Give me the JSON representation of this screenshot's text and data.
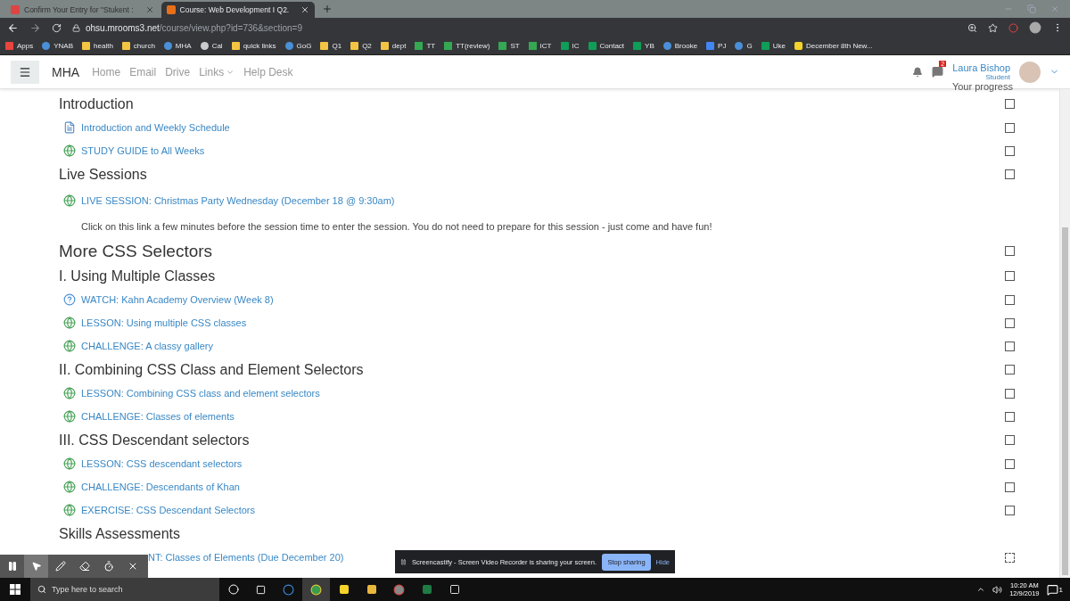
{
  "browser": {
    "tabs": [
      {
        "title": "Confirm Your Entry for \"Stukent :",
        "selected": false
      },
      {
        "title": "Course: Web Development I Q2.",
        "selected": true
      }
    ],
    "address": {
      "host": "ohsu.mrooms3.net",
      "path": "/course/view.php?id=736&section=9"
    },
    "bookmarks": [
      {
        "label": "Apps",
        "kind": "apps"
      },
      {
        "label": "YNAB",
        "kind": "site"
      },
      {
        "label": "health",
        "kind": "folder"
      },
      {
        "label": "church",
        "kind": "folder"
      },
      {
        "label": "MHA",
        "kind": "site"
      },
      {
        "label": "Cal",
        "kind": "globe"
      },
      {
        "label": "quick links",
        "kind": "folder"
      },
      {
        "label": "GoG",
        "kind": "site"
      },
      {
        "label": "Q1",
        "kind": "folder"
      },
      {
        "label": "Q2",
        "kind": "folder"
      },
      {
        "label": "dept",
        "kind": "folder"
      },
      {
        "label": "TT",
        "kind": "drive"
      },
      {
        "label": "TT(review)",
        "kind": "drive"
      },
      {
        "label": "ST",
        "kind": "drive"
      },
      {
        "label": "ICT",
        "kind": "drive"
      },
      {
        "label": "IC",
        "kind": "sheet"
      },
      {
        "label": "Contact",
        "kind": "sheet"
      },
      {
        "label": "YB",
        "kind": "sheet"
      },
      {
        "label": "Brooke",
        "kind": "site"
      },
      {
        "label": "PJ",
        "kind": "doc"
      },
      {
        "label": "G",
        "kind": "site"
      },
      {
        "label": "Uke",
        "kind": "sheet"
      },
      {
        "label": "December 8th New...",
        "kind": "note"
      }
    ]
  },
  "navbar": {
    "brand": "MHA",
    "links": [
      {
        "label": "Home",
        "dropdown": false
      },
      {
        "label": "Email",
        "dropdown": false
      },
      {
        "label": "Drive",
        "dropdown": false
      },
      {
        "label": "Links",
        "dropdown": true
      },
      {
        "label": "Help Desk",
        "dropdown": false
      }
    ],
    "message_badge": "2",
    "user": {
      "name": "Laura Bishop",
      "role": "Student"
    }
  },
  "course": {
    "progress_label": "Your progress",
    "rows": [
      {
        "kind": "section",
        "title": "Introduction",
        "checked": false
      },
      {
        "kind": "page",
        "title": "Introduction and Weekly Schedule",
        "checked": false
      },
      {
        "kind": "link",
        "title": "STUDY GUIDE to All Weeks",
        "checked": false
      },
      {
        "kind": "section",
        "title": "Live Sessions",
        "checked": false
      },
      {
        "kind": "link",
        "title": "LIVE SESSION: Christmas Party Wednesday (December 18 @ 9:30am)"
      },
      {
        "kind": "description",
        "title": "Click on this link a few minutes before the session time to enter the session. You do not need to prepare for this session - just come and have fun!"
      },
      {
        "kind": "heading",
        "title": "More CSS Selectors",
        "checked": false
      },
      {
        "kind": "section",
        "title": "I. Using Multiple Classes",
        "checked": false
      },
      {
        "kind": "question",
        "title": "WATCH: Kahn Academy Overview (Week 8)",
        "checked": false
      },
      {
        "kind": "link",
        "title": "LESSON: Using multiple CSS classes",
        "checked": false
      },
      {
        "kind": "link",
        "title": "CHALLENGE: A classy gallery",
        "checked": false
      },
      {
        "kind": "section",
        "title": "II. Combining CSS Class and Element Selectors",
        "checked": false
      },
      {
        "kind": "link",
        "title": "LESSON: Combining CSS class and element selectors",
        "checked": false
      },
      {
        "kind": "link",
        "title": "CHALLENGE: Classes of elements",
        "checked": false
      },
      {
        "kind": "section",
        "title": "III. CSS Descendant selectors",
        "checked": false
      },
      {
        "kind": "link",
        "title": "LESSON: CSS descendant selectors",
        "checked": false
      },
      {
        "kind": "link",
        "title": "CHALLENGE: Descendants of Khan",
        "checked": false
      },
      {
        "kind": "link",
        "title": "EXERCISE: CSS Descendant Selectors",
        "checked": false
      },
      {
        "kind": "section",
        "title": "Skills Assessments"
      },
      {
        "kind": "cut_link",
        "title": "NT: Classes of Elements (Due December 20)",
        "checked": false
      }
    ]
  },
  "share_bar": {
    "message": "Screencastify - Screen Video Recorder is sharing your screen.",
    "stop_label": "Stop sharing",
    "hide_label": "Hide"
  },
  "taskbar": {
    "search_placeholder": "Type here to search",
    "time": "10:20 AM",
    "date": "12/9/2019",
    "notification_count": "1"
  }
}
